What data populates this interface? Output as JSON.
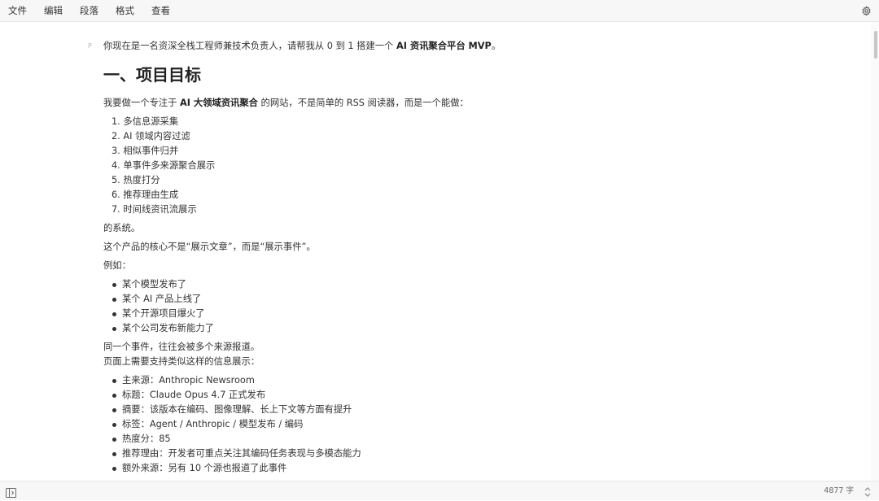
{
  "menu": {
    "items": [
      "文件",
      "编辑",
      "段落",
      "格式",
      "查看"
    ]
  },
  "editor": {
    "p_marker": "P",
    "intro_text": "你现在是一名资深全栈工程师兼技术负责人，请帮我从 0 到 1 搭建一个 ",
    "intro_bold": "AI 资讯聚合平台 MVP",
    "intro_end": "。",
    "heading": "一、项目目标",
    "goal_pre": "我要做一个专注于 ",
    "goal_bold": "AI 大领域资讯聚合",
    "goal_post": " 的网站，不是简单的 RSS 阅读器，而是一个能做：",
    "features": [
      "1. 多信息源采集",
      "2. AI 领域内容过滤",
      "3. 相似事件归并",
      "4. 单事件多来源聚合展示",
      "5. 热度打分",
      "6. 推荐理由生成",
      "7. 时间线资讯流展示"
    ],
    "system_line": "的系统。",
    "core_line": "这个产品的核心不是“展示文章”，而是“展示事件”。",
    "example_label": "例如：",
    "examples": [
      "某个模型发布了",
      "某个 AI 产品上线了",
      "某个开源项目爆火了",
      "某个公司发布新能力了"
    ],
    "same_event_line": "同一个事件，往往会被多个来源报道。",
    "display_line": "页面上需要支持类似这样的信息展示：",
    "display_items": [
      "主来源：Anthropic Newsroom",
      "标题：Claude Opus 4.7 正式发布",
      "摘要：该版本在编码、图像理解、长上下文等方面有提升",
      "标签：Agent / Anthropic / 模型发布 / 编码",
      "热度分：85",
      "推荐理由：开发者可重点关注其编码任务表现与多模态能力",
      "额外来源：另有 10 个源也报道了此事件"
    ]
  },
  "statusbar": {
    "word_count": "4877 字"
  },
  "icons": {
    "settings": "gear-icon",
    "sidebar": "sidebar-toggle-icon",
    "updown": "updown-chevron-icon"
  }
}
